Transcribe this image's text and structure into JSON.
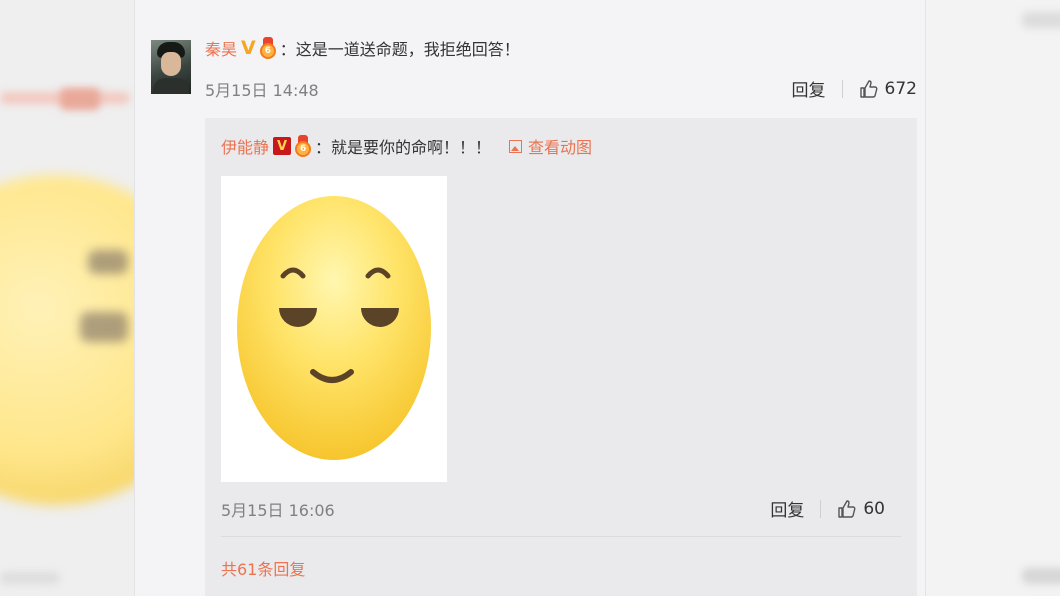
{
  "comment": {
    "username": "秦昊",
    "text": "：这是一道送命题，我拒绝回答！",
    "time": "5月15日 14:48",
    "reply_label": "回复",
    "like_count": "672",
    "verified_badge": "V"
  },
  "reply": {
    "username": "伊能静",
    "text": "：就是要你的命啊！！！",
    "view_gif_label": "查看动图",
    "time": "5月15日 16:06",
    "reply_label": "回复",
    "like_count": "60",
    "verified_badge": "V"
  },
  "total_replies_label": "共61条回复",
  "colors": {
    "username": "#eb7350",
    "verified_gold": "#f5a623",
    "verified_red": "#c9171e",
    "emoji_face": "#ffd84a"
  },
  "icons": {
    "like": "thumbs-up-icon",
    "view_gif": "image-icon",
    "medal": "medal-icon"
  }
}
